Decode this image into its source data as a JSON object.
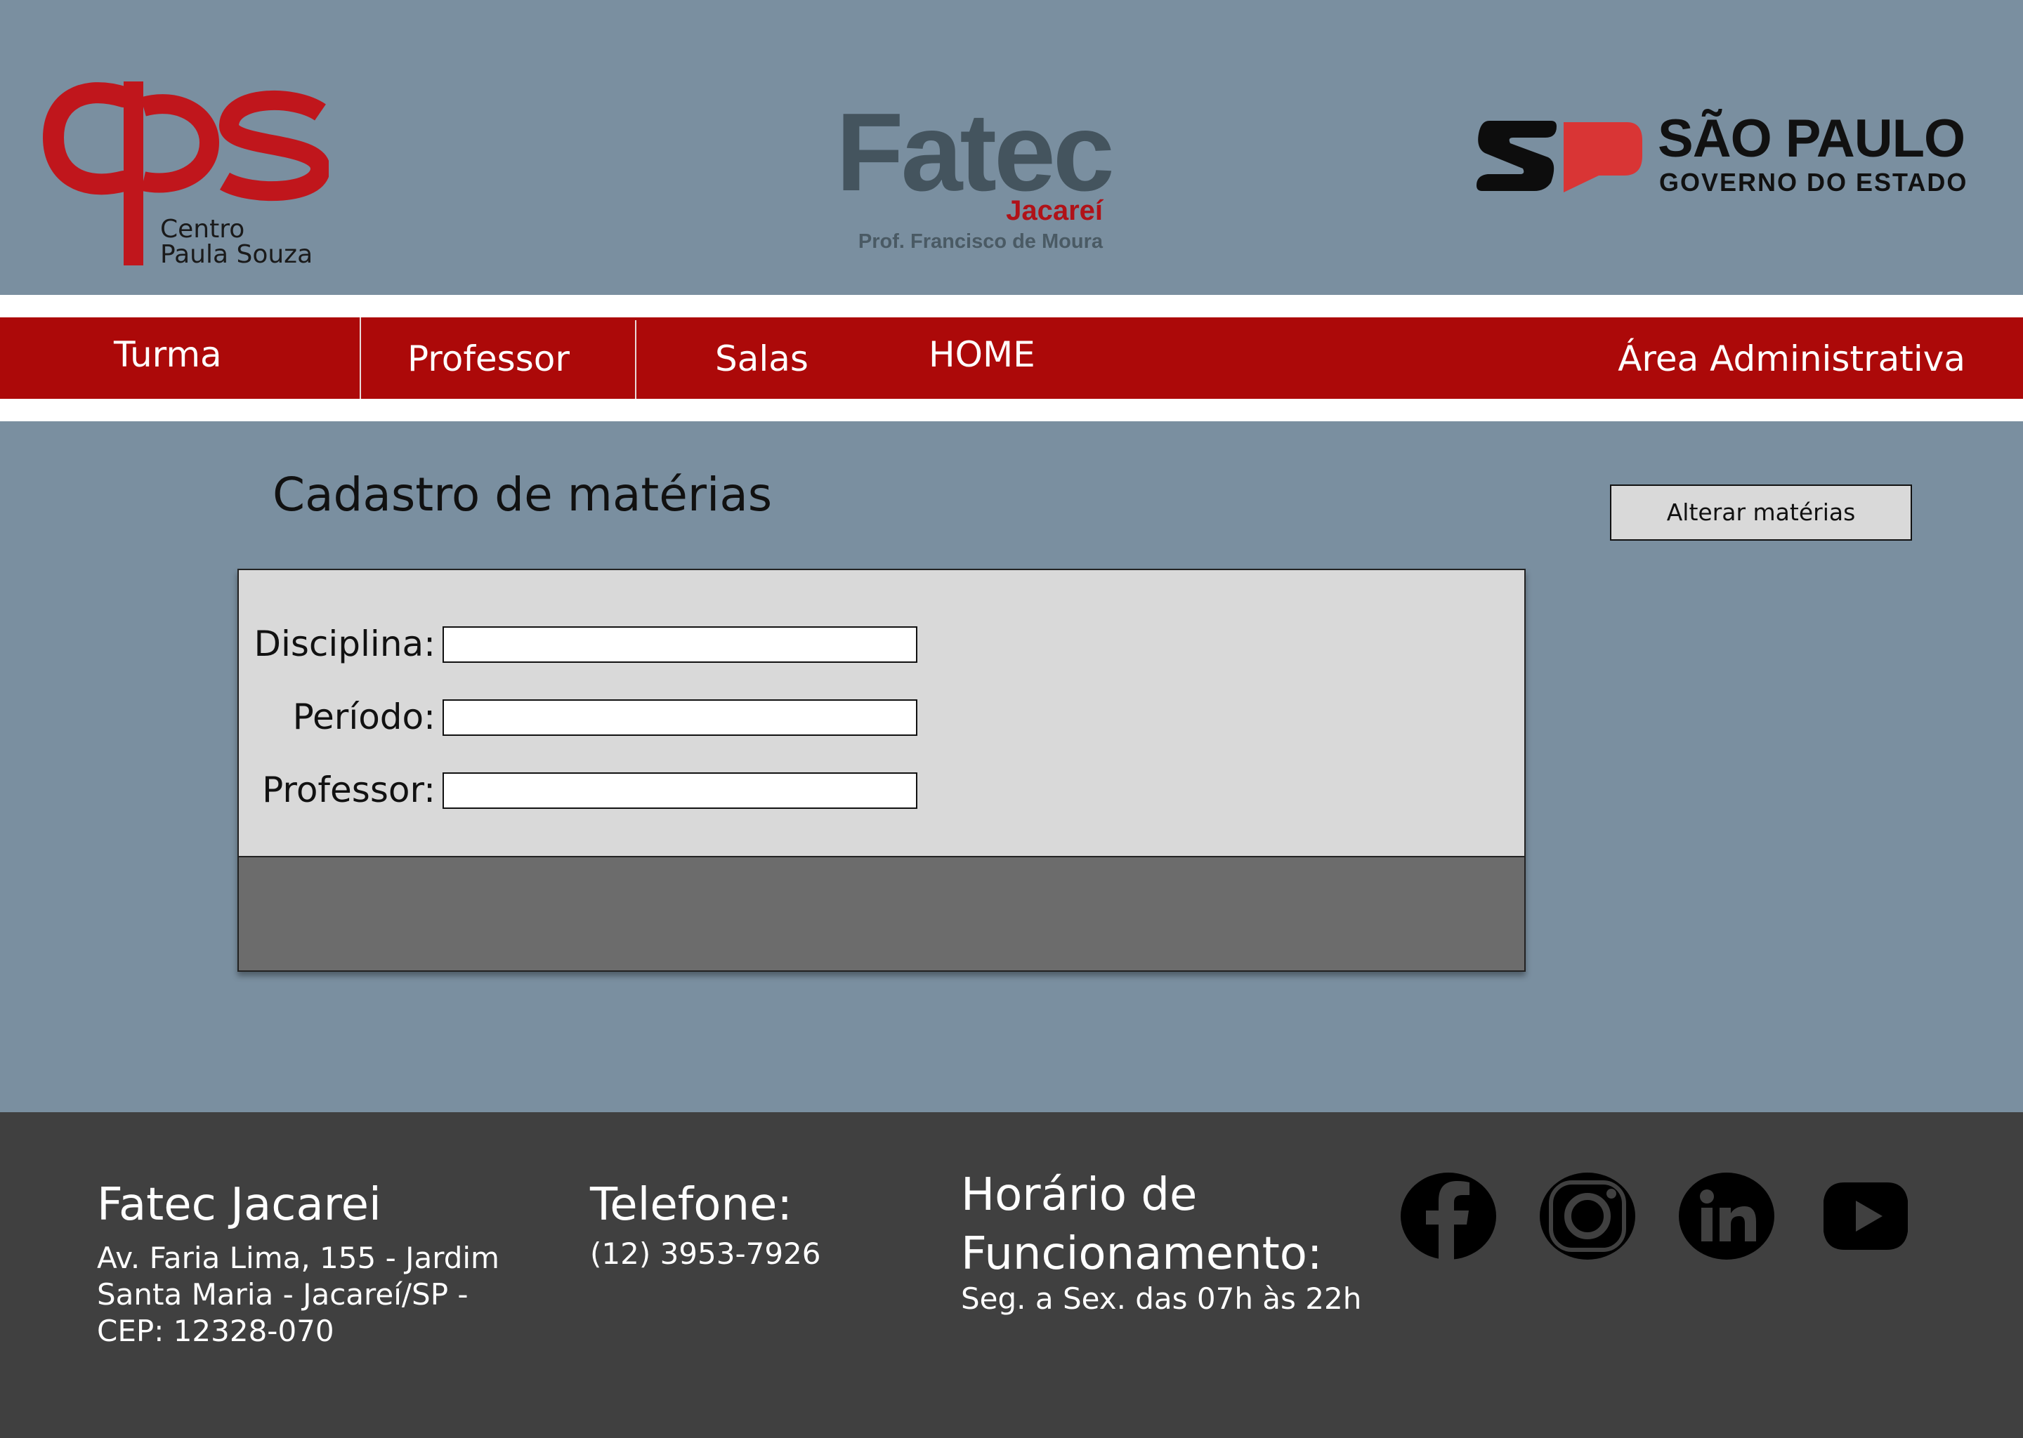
{
  "header": {
    "cps_logo": {
      "line1": "Centro",
      "line2": "Paula Souza"
    },
    "fatec_logo": {
      "word": "Fatec",
      "city": "Jacareí",
      "subtitle": "Prof. Francisco de Moura"
    },
    "sp_logo": {
      "title": "SÃO PAULO",
      "subtitle": "GOVERNO DO ESTADO"
    }
  },
  "nav": {
    "items": [
      {
        "label": "Turma"
      },
      {
        "label": "Professor"
      },
      {
        "label": "Salas"
      },
      {
        "label": "HOME"
      },
      {
        "label": "Área Administrativa"
      }
    ]
  },
  "main": {
    "title": "Cadastro de matérias",
    "alter_button": "Alterar matérias",
    "form": {
      "fields": [
        {
          "label": "Disciplina:",
          "value": "",
          "placeholder": ""
        },
        {
          "label": "Período:",
          "value": "",
          "placeholder": ""
        },
        {
          "label": "Professor:",
          "value": "",
          "placeholder": ""
        }
      ]
    }
  },
  "footer": {
    "school": {
      "title": "Fatec Jacarei",
      "address_lines": [
        "Av. Faria Lima, 155 - Jardim",
        "Santa Maria - Jacareí/SP -",
        "CEP: 12328-070"
      ]
    },
    "phone": {
      "title": "Telefone:",
      "number": "(12) 3953-7926"
    },
    "hours": {
      "title_line1": "Horário de",
      "title_line2": "Funcionamento:",
      "text": "Seg. a Sex. das 07h às 22h"
    },
    "social_icons": [
      "facebook-icon",
      "instagram-icon",
      "linkedin-icon",
      "youtube-icon"
    ],
    "colors": {
      "nav_red": "#ac0909",
      "page_bg": "#7a8fa0",
      "footer_bg": "#404040",
      "card_bg": "#d9d9d9"
    }
  }
}
